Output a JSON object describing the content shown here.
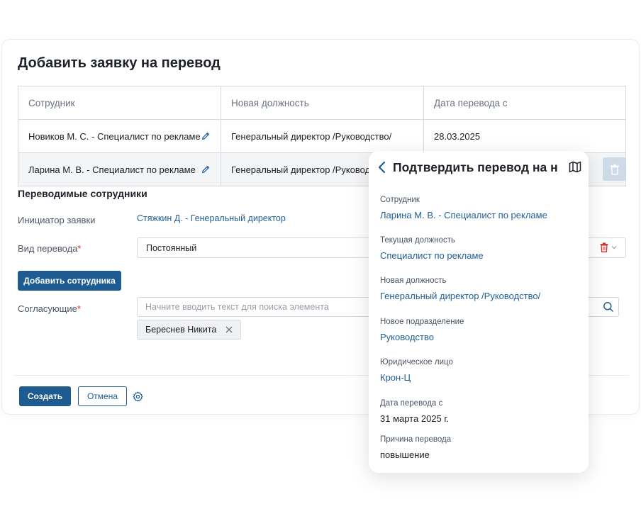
{
  "form": {
    "title": "Добавить заявку на перевод",
    "table": {
      "headers": [
        "Сотрудник",
        "Новая должность",
        "Дата перевода с"
      ],
      "rows": [
        {
          "employee": "Новиков М. С. - Специалист по рекламе",
          "position": "Генеральный директор /Руководство/",
          "date": "28.03.2025"
        },
        {
          "employee": "Ларина М. В. - Специалист по рекламе",
          "position": "Генеральный директор /Руководс",
          "date": ""
        }
      ]
    },
    "section_title": "Переводимые сотрудники",
    "initiator_label": "Инициатор заявки",
    "initiator_value": "Стяжкин Д. - Генеральный директор",
    "transfer_type_label": "Вид перевода",
    "transfer_type_value": "Постоянный",
    "required_mark": "*",
    "add_employee_label": "Добавить сотрудника",
    "approvers_label": "Согласующие",
    "approvers_placeholder": "Начните вводить текст для поиска элемента",
    "approver_chip": "Береснев Никита",
    "create_label": "Создать",
    "cancel_label": "Отмена"
  },
  "panel": {
    "title": "Подтвердить перевод на н",
    "fields": [
      {
        "label": "Сотрудник",
        "value": "Ларина М. В. - Специалист по рекламе"
      },
      {
        "label": "Текущая должность",
        "value": "Специалист по рекламе"
      },
      {
        "label": "Новая должность",
        "value": "Генеральный директор /Руководство/"
      },
      {
        "label": "Новое подразделение",
        "value": "Руководство"
      },
      {
        "label": "Юридическое лицо",
        "value": "Крон-Ц"
      },
      {
        "label": "Дата перевода с",
        "value": "31 марта 2025 г."
      },
      {
        "label": "Причина перевода",
        "value": "повышение"
      }
    ]
  },
  "colors": {
    "primary": "#1d5b91",
    "link": "#1f5e96",
    "danger": "#d93025"
  },
  "icons": [
    "pencil-icon",
    "trash-icon",
    "chevron-down-icon",
    "search-icon",
    "close-icon",
    "gear-icon",
    "back-arrow-icon",
    "map-icon"
  ]
}
